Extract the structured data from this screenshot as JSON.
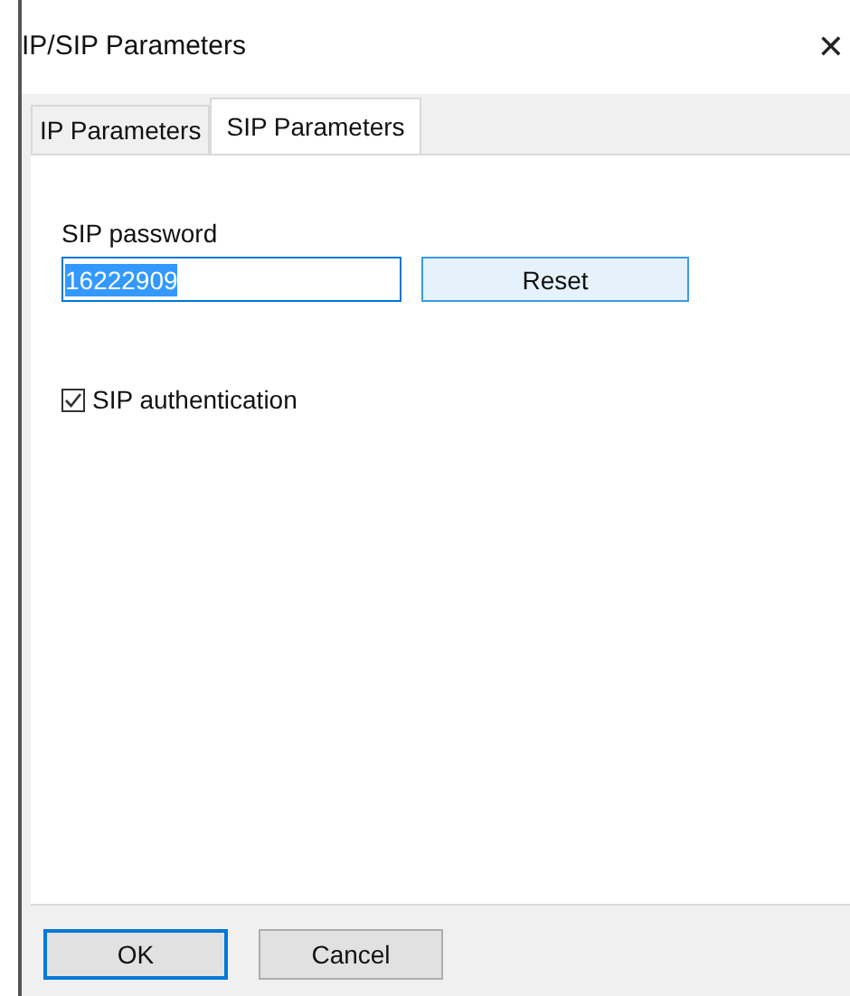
{
  "window": {
    "title": "IP/SIP Parameters",
    "close": "✕"
  },
  "tabs": [
    {
      "label": "IP Parameters",
      "selected": false
    },
    {
      "label": "SIP Parameters",
      "selected": true
    }
  ],
  "password": {
    "label": "SIP password",
    "value": "16222909"
  },
  "reset_button": "Reset",
  "authentication": {
    "label": "SIP authentication",
    "checked": true
  },
  "buttons": [
    {
      "label": "OK",
      "default": true
    },
    {
      "label": "Cancel",
      "default": false
    }
  ]
}
